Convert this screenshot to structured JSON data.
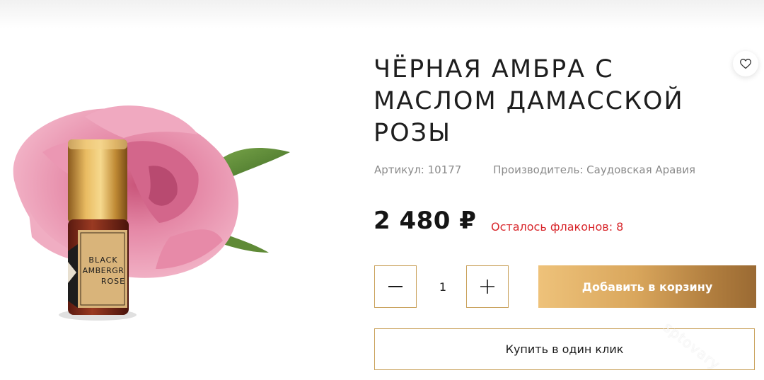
{
  "product": {
    "title": "ЧЁРНАЯ АМБРА С МАСЛОМ ДАМАССКОЙ РОЗЫ",
    "sku_label": "Артикул: 10177",
    "maker_label": "Производитель: Саудовская Аравия",
    "price": "2 480 ₽",
    "stock_text": "Осталось флаконов: 8",
    "bottle_label_lines": [
      "BLACK",
      "AMBERGR",
      "ROSE"
    ]
  },
  "quantity": {
    "value": "1"
  },
  "actions": {
    "add_to_cart": "Добавить в корзину",
    "one_click": "Купить в один клик"
  },
  "icons": {
    "wishlist": "heart-icon",
    "minus": "minus-icon",
    "plus": "plus-icon"
  },
  "watermark": "sptovary",
  "colors": {
    "accent_gold": "#c9a15a",
    "stock_red": "#d8262b",
    "rose_pink": "#e58aa8"
  }
}
